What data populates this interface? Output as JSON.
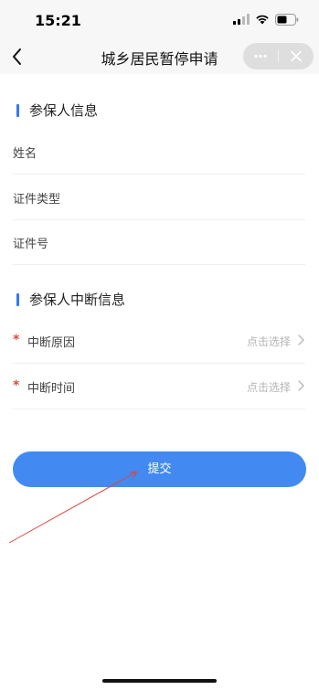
{
  "status_bar": {
    "time": "15:21"
  },
  "nav": {
    "title": "城乡居民暂停申请",
    "back_icon": "chevron-left-icon",
    "more_icon": "more-dots-icon",
    "close_icon": "close-icon"
  },
  "sections": {
    "insured_info": {
      "title": "参保人信息",
      "fields": [
        {
          "label": "姓名"
        },
        {
          "label": "证件类型"
        },
        {
          "label": "证件号"
        }
      ]
    },
    "interrupt_info": {
      "title": "参保人中断信息",
      "fields": [
        {
          "label": "中断原因",
          "required": "*",
          "placeholder": "点击选择"
        },
        {
          "label": "中断时间",
          "required": "*",
          "placeholder": "点击选择"
        }
      ]
    }
  },
  "submit": {
    "label": "提交"
  },
  "colors": {
    "accent": "#428af2",
    "section_bar": "#3478f6",
    "required": "#e04a3f",
    "annotation": "#e0443a"
  }
}
